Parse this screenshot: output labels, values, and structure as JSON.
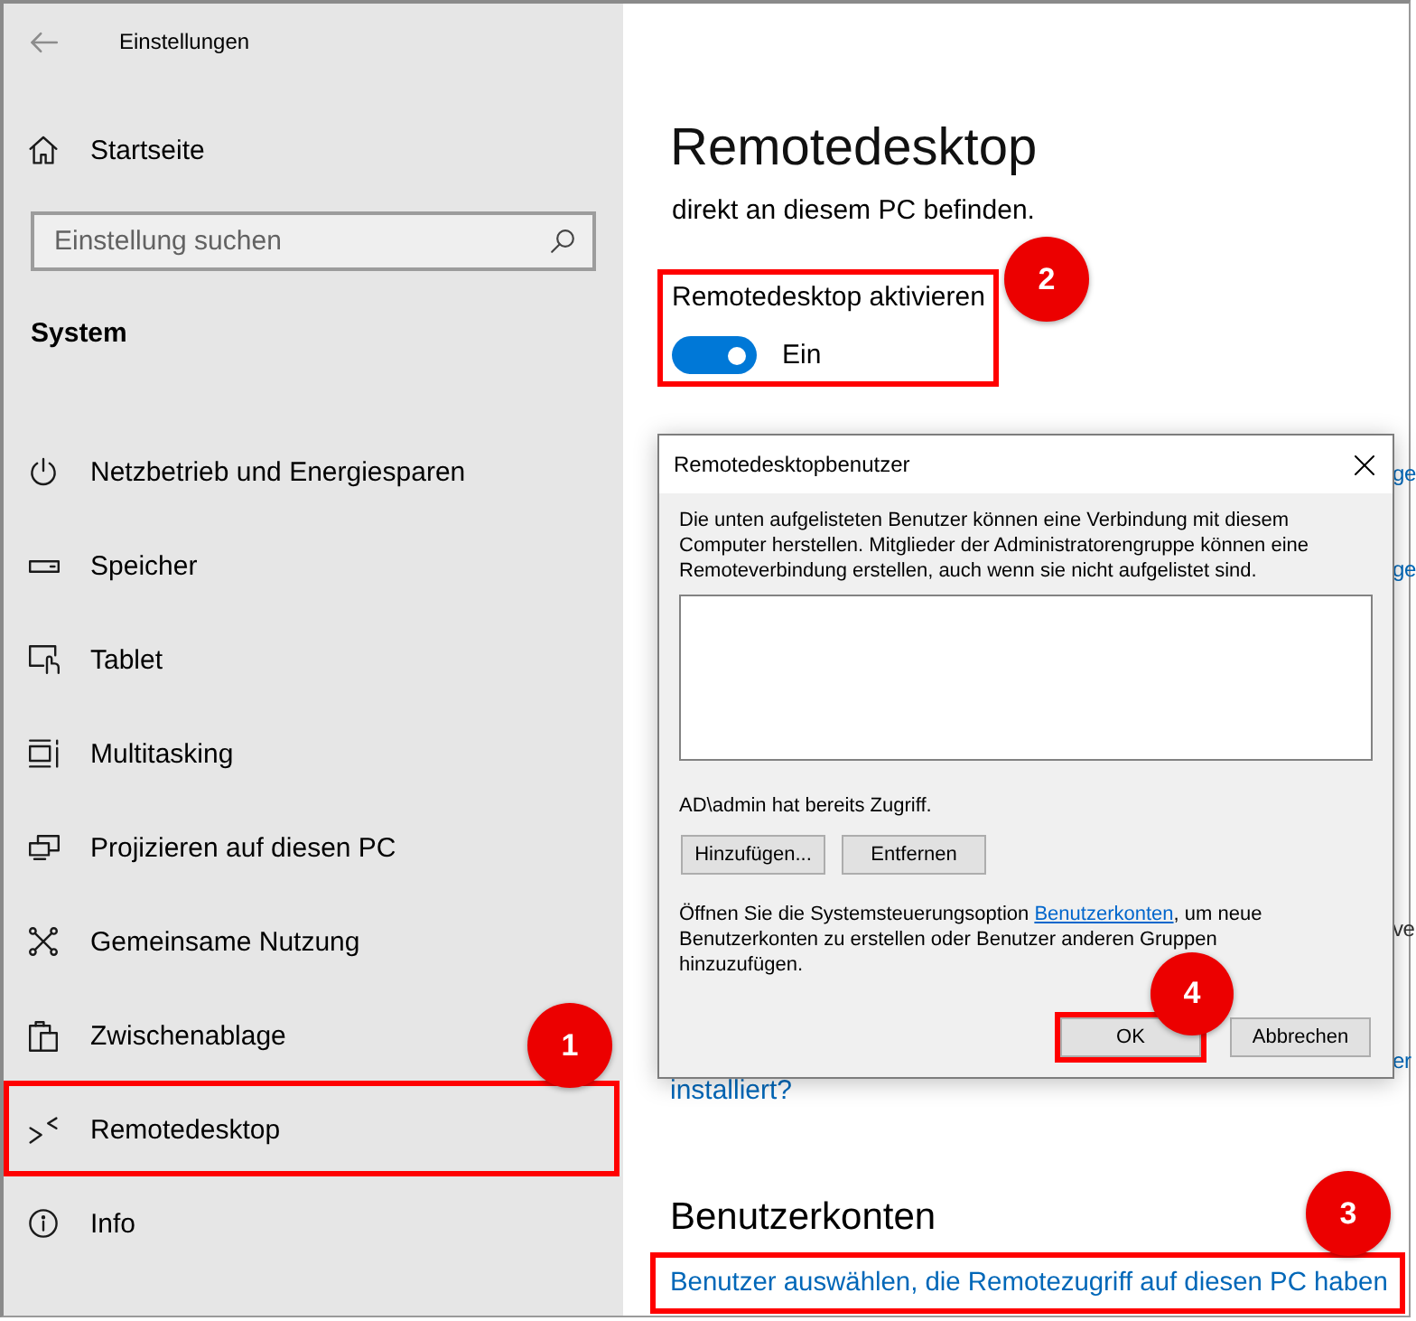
{
  "window": {
    "title": "Einstellungen"
  },
  "sidebar": {
    "home": "Startseite",
    "search": {
      "placeholder": "Einstellung suchen"
    },
    "section": "System",
    "items": [
      {
        "label": "Netzbetrieb und Energiesparen"
      },
      {
        "label": "Speicher"
      },
      {
        "label": "Tablet"
      },
      {
        "label": "Multitasking"
      },
      {
        "label": "Projizieren auf diesen PC"
      },
      {
        "label": "Gemeinsame Nutzung"
      },
      {
        "label": "Zwischenablage"
      },
      {
        "label": "Remotedesktop",
        "callout": "1"
      },
      {
        "label": "Info"
      }
    ]
  },
  "content": {
    "title": "Remotedesktop",
    "intro": "direkt an diesem PC befinden.",
    "toggle": {
      "label": "Remotedesktop aktivieren",
      "on": true,
      "state_text": "Ein",
      "callout": "2"
    },
    "covered_fragments": [
      {
        "kind": "link",
        "text": "ge"
      },
      {
        "kind": "link",
        "text": "ge"
      },
      {
        "kind": "text",
        "text": "ve"
      },
      {
        "kind": "link",
        "text": "er"
      }
    ],
    "help_link": "installiert?",
    "accounts": {
      "heading": "Benutzerkonten",
      "link": "Benutzer auswählen, die Remotezugriff auf diesen PC haben",
      "callout": "3"
    }
  },
  "dialog": {
    "title": "Remotedesktopbenutzer",
    "description": "Die unten aufgelisteten Benutzer können eine Verbindung mit diesem Computer herstellen. Mitglieder der Administratorengruppe können eine Remoteverbindung erstellen, auch wenn sie nicht aufgelistet sind.",
    "access_note": "AD\\admin hat bereits Zugriff.",
    "list_buttons": [
      {
        "label": "Hinzufügen..."
      },
      {
        "label": "Entfernen"
      }
    ],
    "hint": {
      "before": "Öffnen Sie die Systemsteuerungsoption ",
      "link": "Benutzerkonten",
      "after": ", um neue Benutzerkonten zu erstellen oder Benutzer anderen Gruppen hinzuzufügen."
    },
    "footer_buttons": [
      {
        "label": "OK",
        "callout": "4"
      },
      {
        "label": "Abbrechen"
      }
    ]
  }
}
